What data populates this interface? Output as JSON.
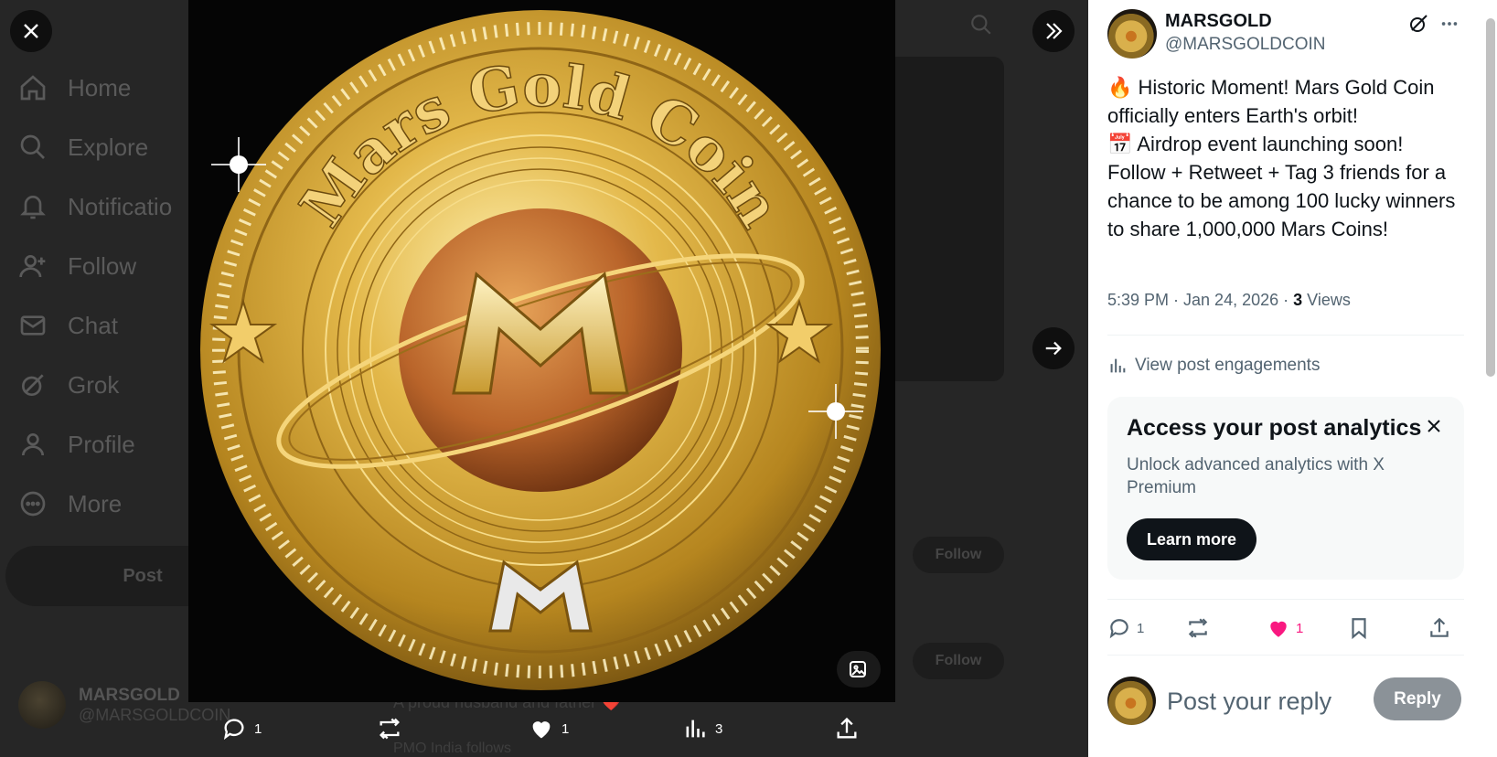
{
  "background_app": {
    "nav": [
      {
        "label": "Home",
        "icon": "home-icon"
      },
      {
        "label": "Explore",
        "icon": "search-icon"
      },
      {
        "label": "Notificatio",
        "icon": "bell-icon"
      },
      {
        "label": "Follow",
        "icon": "follow-icon"
      },
      {
        "label": "Chat",
        "icon": "mail-icon"
      },
      {
        "label": "Grok",
        "icon": "grok-icon"
      },
      {
        "label": "Profile",
        "icon": "person-icon"
      },
      {
        "label": "More",
        "icon": "more-icon"
      }
    ],
    "post_button": "Post",
    "account": {
      "name": "MARSGOLD",
      "handle": "@MARSGOLDCOIN"
    },
    "feed_snippets": [
      "A proud husband and father ❤️",
      "PMO India follows"
    ],
    "follow_buttons": [
      "Follow",
      "Follow"
    ]
  },
  "media": {
    "coin_text": "Mars Gold Coin",
    "actions": {
      "replies": "1",
      "reposts": "",
      "likes": "1",
      "views": "3"
    }
  },
  "post": {
    "author_name": "MARSGOLD",
    "author_handle": "@MARSGOLDCOIN",
    "text": "🔥 Historic Moment! Mars Gold Coin officially enters Earth's orbit!\n📅 Airdrop event launching soon!\nFollow + Retweet + Tag 3 friends for a chance to be among 100 lucky winners to share 1,000,000 Mars Coins!",
    "time": "5:39 PM · Jan 24, 2026 · ",
    "views_count": "3",
    "views_label": " Views",
    "engagements_link": "View post engagements",
    "analytics": {
      "title": "Access your post analytics",
      "subtitle": "Unlock advanced analytics with X Premium",
      "button": "Learn more"
    },
    "actions": {
      "replies": "1",
      "likes": "1"
    },
    "reply_placeholder": "Post your reply",
    "reply_button": "Reply"
  },
  "colors": {
    "like_pink": "#f91880",
    "text_primary": "#0f1419",
    "text_secondary": "#536471",
    "coin_gold": "#d4a93a"
  }
}
